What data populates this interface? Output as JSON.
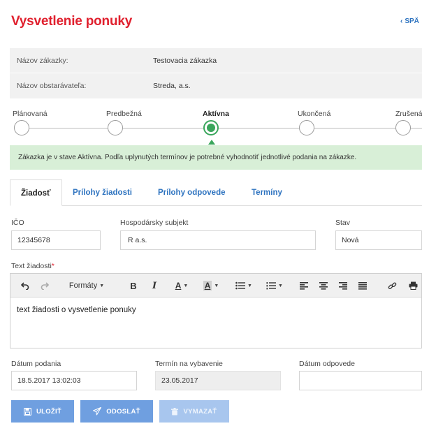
{
  "header": {
    "title": "Vysvetlenie ponuky",
    "back_label": "SPÄ"
  },
  "info": {
    "contract_label": "Názov zákazky:",
    "contract_value": "Testovacia  zákazka",
    "authority_label": "Názov obstarávateľa:",
    "authority_value": "Streda, a.s."
  },
  "steps": {
    "items": [
      {
        "label": "Plánovaná"
      },
      {
        "label": "Predbežná"
      },
      {
        "label": "Aktívna"
      },
      {
        "label": "Ukončená"
      },
      {
        "label": "Zrušená"
      }
    ]
  },
  "alert": {
    "text": "Zákazka je v stave Aktívna. Podľa uplynutých termínov je potrebné vyhodnotiť jednotlivé podania na zákazke."
  },
  "tabs": {
    "items": [
      {
        "label": "Žiadosť"
      },
      {
        "label": "Prílohy žiadosti"
      },
      {
        "label": "Prílohy odpovede"
      },
      {
        "label": "Termíny"
      }
    ]
  },
  "form": {
    "ico_label": "IČO",
    "ico_value": "12345678",
    "subject_label": "Hospodársky subjekt",
    "subject_value": "R     a.s.",
    "status_label": "Stav",
    "status_value": "Nová",
    "text_label": "Text žiadosti",
    "required_mark": "*",
    "submitted_label": "Dátum podania",
    "submitted_value": "18.5.2017 13:02:03",
    "deadline_label": "Termín na vybavenie",
    "deadline_value": "23.05.2017",
    "reply_label": "Dátum odpovede",
    "reply_value": ""
  },
  "editor": {
    "formats_label": "Formáty",
    "content": "text žiadosti o vysvetlenie  ponuky"
  },
  "actions": {
    "save_label": "ULOŽIŤ",
    "send_label": "ODOSLAŤ",
    "delete_label": "VYMAZAŤ"
  },
  "colors": {
    "title": "#e0202e",
    "link": "#2f74c0",
    "active_step": "#3aa65c",
    "alert_bg": "#d8efd7",
    "button": "#6f9fe0"
  }
}
